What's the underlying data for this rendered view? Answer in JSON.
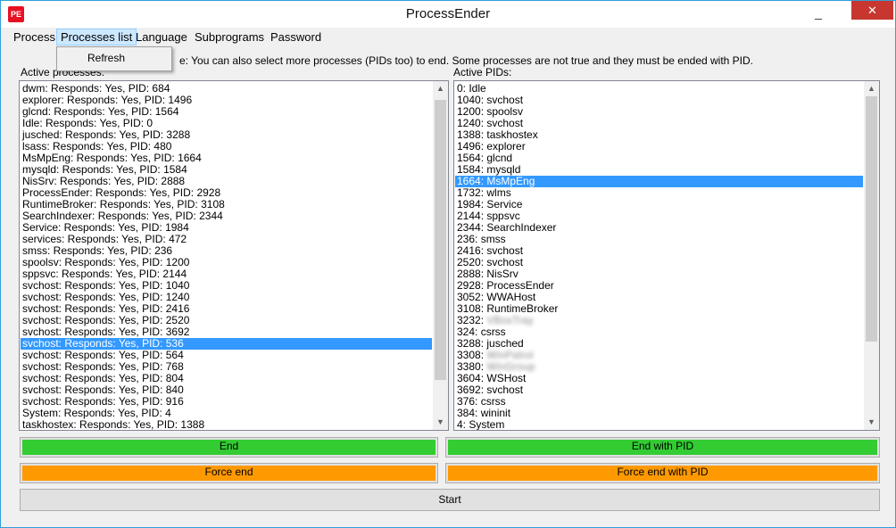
{
  "window": {
    "title": "ProcessEnder",
    "icon_text": "PE",
    "minimize_glyph": "_",
    "close_glyph": "✕"
  },
  "menu": {
    "items": [
      "Process",
      "Processes list",
      "Language",
      "Subprograms",
      "Password"
    ],
    "open_menu": {
      "items": [
        "Refresh"
      ]
    }
  },
  "hint": "e: You can also select more processes (PIDs too) to end. Some processes are not true and they must be ended with PID.",
  "processes_panel": {
    "label": "Active processes:",
    "items": [
      "dwm: Responds: Yes, PID: 684",
      "explorer: Responds: Yes, PID: 1496",
      "glcnd: Responds: Yes, PID: 1564",
      "Idle: Responds: Yes, PID: 0",
      "jusched: Responds: Yes, PID: 3288",
      "lsass: Responds: Yes, PID: 480",
      "MsMpEng: Responds: Yes, PID: 1664",
      "mysqld: Responds: Yes, PID: 1584",
      "NisSrv: Responds: Yes, PID: 2888",
      "ProcessEnder: Responds: Yes, PID: 2928",
      "RuntimeBroker: Responds: Yes, PID: 3108",
      "SearchIndexer: Responds: Yes, PID: 2344",
      "Service: Responds: Yes, PID: 1984",
      "services: Responds: Yes, PID: 472",
      "smss: Responds: Yes, PID: 236",
      "spoolsv: Responds: Yes, PID: 1200",
      "sppsvc: Responds: Yes, PID: 2144",
      "svchost: Responds: Yes, PID: 1040",
      "svchost: Responds: Yes, PID: 1240",
      "svchost: Responds: Yes, PID: 2416",
      "svchost: Responds: Yes, PID: 2520",
      "svchost: Responds: Yes, PID: 3692",
      "svchost: Responds: Yes, PID: 536",
      "svchost: Responds: Yes, PID: 564",
      "svchost: Responds: Yes, PID: 768",
      "svchost: Responds: Yes, PID: 804",
      "svchost: Responds: Yes, PID: 840",
      "svchost: Responds: Yes, PID: 916",
      "System: Responds: Yes, PID: 4",
      "taskhostex: Responds: Yes, PID: 1388"
    ],
    "selected_index": 22,
    "scroll_position": 0.1,
    "scroll_fraction": 0.88
  },
  "pids_panel": {
    "label": "Active PIDs:",
    "items": [
      {
        "text": "0: Idle"
      },
      {
        "text": "1040: svchost"
      },
      {
        "text": "1200: spoolsv"
      },
      {
        "text": "1240: svchost"
      },
      {
        "text": "1388: taskhostex"
      },
      {
        "text": "1496: explorer"
      },
      {
        "text": "1564: glcnd"
      },
      {
        "text": "1584: mysqld"
      },
      {
        "text": "1664: MsMpEng"
      },
      {
        "text": "1732: wlms"
      },
      {
        "text": "1984: Service"
      },
      {
        "text": "2144: sppsvc"
      },
      {
        "text": "2344: SearchIndexer"
      },
      {
        "text": "236: smss"
      },
      {
        "text": "2416: svchost"
      },
      {
        "text": "2520: svchost"
      },
      {
        "text": "2888: NisSrv"
      },
      {
        "text": "2928: ProcessEnder"
      },
      {
        "text": "3052: WWAHost"
      },
      {
        "text": "3108: RuntimeBroker"
      },
      {
        "text": "3232: ",
        "blurred": "VBoxTray"
      },
      {
        "text": "324: csrss"
      },
      {
        "text": "3288: jusched"
      },
      {
        "text": "3308: ",
        "blurred": "WinPatrol"
      },
      {
        "text": "3380: ",
        "blurred": "WinGroup"
      },
      {
        "text": "3604: WSHost"
      },
      {
        "text": "3692: svchost"
      },
      {
        "text": "376: csrss"
      },
      {
        "text": "384: wininit"
      },
      {
        "text": "4: System"
      }
    ],
    "selected_index": 8,
    "scroll_position": 0.0,
    "scroll_fraction": 0.77
  },
  "buttons": {
    "end": "End",
    "end_with_pid": "End with PID",
    "force_end": "Force end",
    "force_end_with_pid": "Force end with PID",
    "start": "Start"
  },
  "colors": {
    "selection": "#3399ff",
    "end_green": "#33cc33",
    "force_orange": "#ff9900",
    "close_red": "#c7372f"
  }
}
